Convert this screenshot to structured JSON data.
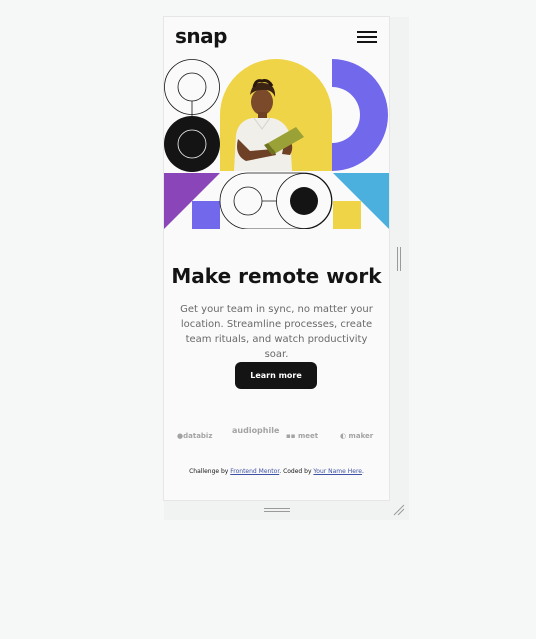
{
  "brand": {
    "logo": "snap"
  },
  "nav": {
    "menu_icon": "hamburger-menu-icon"
  },
  "hero": {
    "headline": "Make remote work",
    "description": "Get your team in sync, no matter your location. Streamline processes, create team rituals, and watch productivity soar.",
    "cta_label": "Learn more"
  },
  "clients": [
    {
      "name": "databiz"
    },
    {
      "name": "audiophile"
    },
    {
      "name": "meet"
    },
    {
      "name": "maker"
    }
  ],
  "footer": {
    "prefix": "Challenge by ",
    "mentor_link": "Frontend Mentor",
    "middle": ". Coded by ",
    "author_link": "Your Name Here",
    "suffix": "."
  },
  "colors": {
    "text_dark": "#141414",
    "text_gray": "#696969",
    "yellow": "#f0d447",
    "purple_blue": "#7168ec",
    "magenta": "#8a46b8",
    "cyan": "#4cb0de",
    "link": "#3e52a3"
  }
}
